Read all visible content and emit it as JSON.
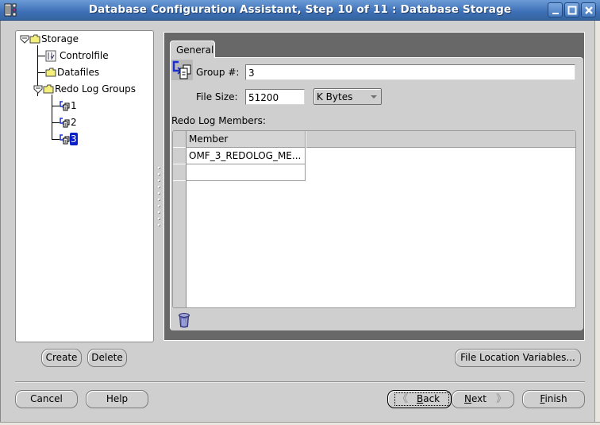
{
  "window": {
    "title": "Database Configuration Assistant, Step 10 of 11 : Database Storage",
    "controls": [
      "minimize",
      "maximize",
      "close"
    ]
  },
  "tree": {
    "nodes": [
      {
        "label": "Storage",
        "icon": "folder-icon",
        "expanded": true,
        "level": 0
      },
      {
        "label": "Controlfile",
        "icon": "controlfile-icon",
        "level": 1
      },
      {
        "label": "Datafiles",
        "icon": "folder-icon",
        "level": 1
      },
      {
        "label": "Redo Log Groups",
        "icon": "folder-icon",
        "expanded": true,
        "level": 1
      },
      {
        "label": "1",
        "icon": "redo-log-group-icon",
        "level": 2
      },
      {
        "label": "2",
        "icon": "redo-log-group-icon",
        "level": 2
      },
      {
        "label": "3",
        "icon": "redo-log-group-icon",
        "level": 2,
        "selected": true
      }
    ],
    "create_label": "Create",
    "delete_label": "Delete"
  },
  "detail": {
    "tab_label": "General",
    "group_label": "Group #:",
    "group_value": "3",
    "file_size_label": "File Size:",
    "file_size_value": "51200",
    "file_size_unit": "K Bytes",
    "members_label": "Redo Log Members:",
    "members_table": {
      "columns": [
        "Member"
      ],
      "rows": [
        [
          "OMF_3_REDOLOG_ME..."
        ],
        [
          ""
        ]
      ]
    },
    "delete_member_icon": "trash-icon"
  },
  "buttons": {
    "file_location_variables": "File Location Variables...",
    "cancel": "Cancel",
    "help": "Help",
    "back": "Back",
    "back_mnemonic": "B",
    "back_rest": "ack",
    "next": "Next",
    "next_mnemonic": "N",
    "next_rest": "ext",
    "finish": "Finish",
    "finish_mnemonic": "F",
    "finish_rest": "inish"
  },
  "colors": {
    "titlebar": "#3d6fb6",
    "selection": "#0a1fc9",
    "panel_bg": "#cfcfcf",
    "tab_frame": "#686868"
  }
}
